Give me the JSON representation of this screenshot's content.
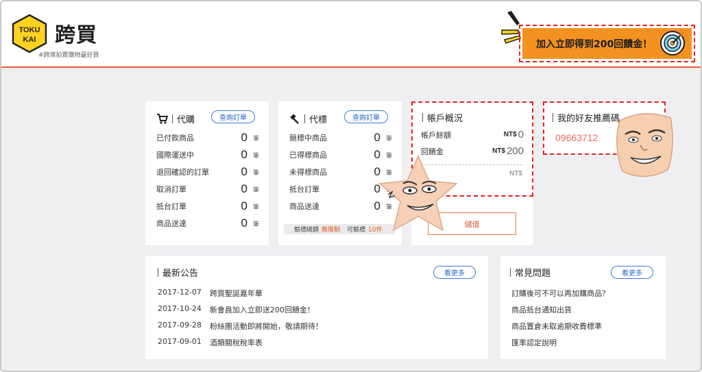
{
  "header": {
    "logo_line1": "TOKU",
    "logo_line2": "KAI",
    "brand": "跨買",
    "tagline": "#跨境拍賣購物最好買",
    "promo_text": "加入立即得到200回饋金！"
  },
  "purchase": {
    "title": "代購",
    "button": "查詢訂單",
    "rows": [
      {
        "label": "已付款商品",
        "count": "0",
        "unit": "筆"
      },
      {
        "label": "國際運送中",
        "count": "0",
        "unit": "筆"
      },
      {
        "label": "退回確認的訂單",
        "count": "0",
        "unit": "筆"
      },
      {
        "label": "取消訂單",
        "count": "0",
        "unit": "筆"
      },
      {
        "label": "抵台訂單",
        "count": "0",
        "unit": "筆"
      },
      {
        "label": "商品送達",
        "count": "0",
        "unit": "筆"
      }
    ]
  },
  "bidding": {
    "title": "代標",
    "button": "查詢訂單",
    "rows": [
      {
        "label": "競標中商品",
        "count": "0",
        "unit": "筆"
      },
      {
        "label": "已得標商品",
        "count": "0",
        "unit": "筆"
      },
      {
        "label": "未得標商品",
        "count": "0",
        "unit": "筆"
      },
      {
        "label": "抵台訂單",
        "count": "0",
        "unit": "筆"
      },
      {
        "label": "商品送達",
        "count": "0",
        "unit": "筆"
      }
    ],
    "footer_label1": "競標總額",
    "footer_value1": "無限制",
    "footer_label2": "可競標",
    "footer_value2": "10件"
  },
  "account": {
    "title": "帳戶概況",
    "balance_label": "帳戶餘額",
    "balance_currency": "NT$",
    "balance_value": "0",
    "rebate_label": "回饋金",
    "rebate_currency": "NT$",
    "rebate_value": "200",
    "third_currency": "NT$",
    "deposit_button": "儲值"
  },
  "referral": {
    "title": "我的好友推薦碼",
    "code": "09663712"
  },
  "news": {
    "title": "最新公告",
    "more": "看更多",
    "items": [
      {
        "date": "2017-12-07",
        "text": "跨買聖誕嘉年華"
      },
      {
        "date": "2017-10-24",
        "text": "新會員加入立即送200回饋金！"
      },
      {
        "date": "2017-09-28",
        "text": "粉絲團活動即將開始，敬請期待！"
      },
      {
        "date": "2017-09-01",
        "text": "酒類關稅稅率表"
      }
    ]
  },
  "faq": {
    "title": "常見問題",
    "more": "看更多",
    "items": [
      "訂購後可不可以再加購商品？",
      "商品抵台通知出貨",
      "商品置倉未取逾期收費標準",
      "匯率認定說明"
    ]
  },
  "colors": {
    "accent": "#e95c35",
    "promo_bg": "#f39221",
    "dashed_red": "#e21e1e",
    "link_blue": "#2a6bc9",
    "referral_code": "#ef6b5a"
  }
}
